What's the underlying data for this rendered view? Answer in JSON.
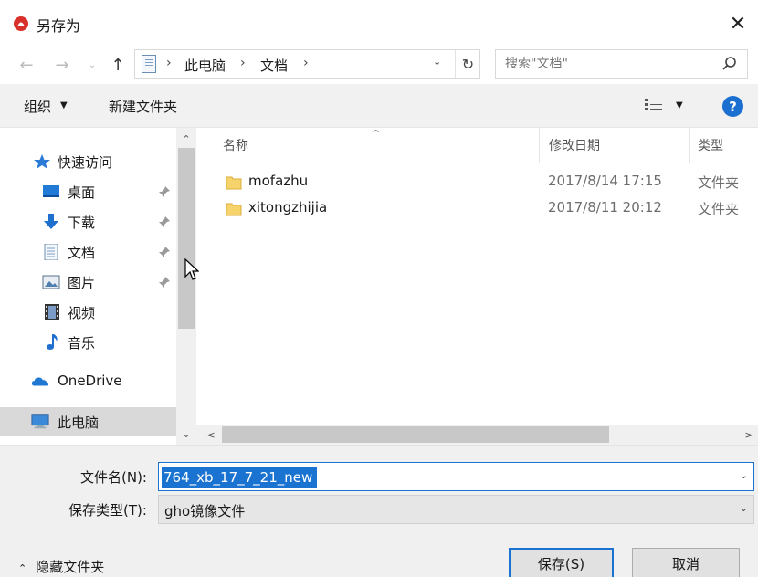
{
  "window": {
    "title": "另存为",
    "close_glyph": "✕"
  },
  "nav": {
    "back_glyph": "←",
    "forward_glyph": "→",
    "recent_glyph": "⌄",
    "up_glyph": "↑"
  },
  "address": {
    "crumbs": [
      "此电脑",
      "文档"
    ],
    "separator": "›",
    "dropdown_glyph": "⌄",
    "refresh_glyph": "↻"
  },
  "search": {
    "placeholder": "搜索\"文档\""
  },
  "toolbar": {
    "organize_label": "组织",
    "organize_caret": "▼",
    "new_folder_label": "新建文件夹",
    "view_caret": "▼",
    "help_label": "?"
  },
  "sidebar": {
    "items": [
      {
        "label": "快速访问",
        "icon": "star-icon"
      },
      {
        "label": "桌面",
        "icon": "desktop-icon",
        "pinned": true
      },
      {
        "label": "下载",
        "icon": "download-icon",
        "pinned": true
      },
      {
        "label": "文档",
        "icon": "document-icon",
        "pinned": true
      },
      {
        "label": "图片",
        "icon": "pictures-icon",
        "pinned": true
      },
      {
        "label": "视频",
        "icon": "video-icon"
      },
      {
        "label": "音乐",
        "icon": "music-icon"
      },
      {
        "label": "OneDrive",
        "icon": "onedrive-icon"
      },
      {
        "label": "此电脑",
        "icon": "computer-icon",
        "selected": true
      }
    ]
  },
  "columns": {
    "name": "名称",
    "date": "修改日期",
    "type": "类型"
  },
  "files": [
    {
      "name": "mofazhu",
      "date": "2017/8/14 17:15",
      "type": "文件夹"
    },
    {
      "name": "xitongzhijia",
      "date": "2017/8/11 20:12",
      "type": "文件夹"
    }
  ],
  "scroll": {
    "up_glyph": "⌃",
    "down_glyph": "⌄",
    "left_glyph": "<",
    "right_glyph": ">"
  },
  "form": {
    "filename_label": "文件名(N):",
    "filename_value": "764_xb_17_7_21_new",
    "filetype_label": "保存类型(T):",
    "filetype_value": "gho镜像文件",
    "dropdown_glyph": "⌄",
    "hide_folders_caret": "⌃",
    "hide_folders_label": "隐藏文件夹",
    "save_label": "保存(S)",
    "cancel_label": "取消"
  },
  "colors": {
    "accent": "#1a73d1",
    "selected_bg": "#d9d9d9",
    "folder_yellow": "#f6d46b",
    "toolbar_bg": "#f1f1f1",
    "help_blue": "#1a6fd1"
  }
}
